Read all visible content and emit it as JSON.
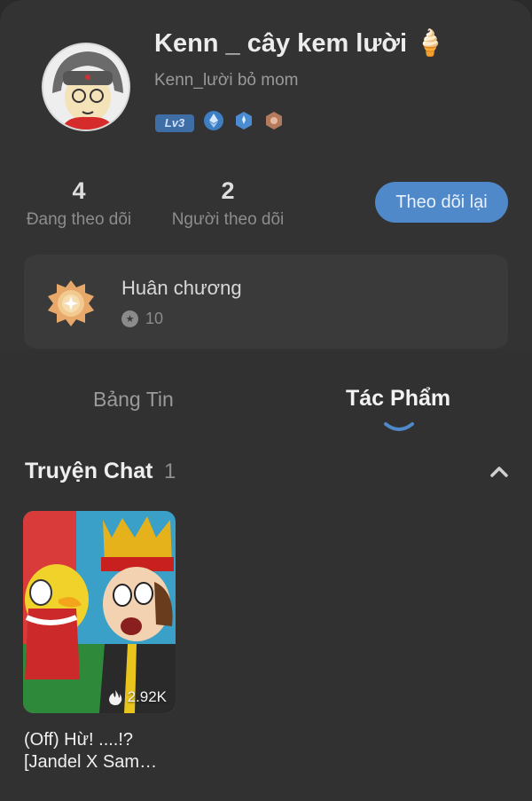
{
  "profile": {
    "display_name": "Kenn _ cây kem lười 🍦",
    "username": "Kenn_lười bỏ mom",
    "level_badge": "Lv3"
  },
  "stats": {
    "following_count": "4",
    "following_label": "Đang theo dõi",
    "followers_count": "2",
    "followers_label": "Người theo dõi",
    "follow_back_label": "Theo dõi lại"
  },
  "medals": {
    "title": "Huân chương",
    "count": "10"
  },
  "tabs": [
    {
      "label": "Bảng Tin",
      "active": false
    },
    {
      "label": "Tác Phẩm",
      "active": true
    }
  ],
  "section": {
    "title": "Truyện Chat",
    "count": "1"
  },
  "works": [
    {
      "title": "(Off) Hừ! ....!? [Jandel X Sam…",
      "views": "2.92K"
    }
  ],
  "colors": {
    "accent": "#4f89c9",
    "background": "#313132",
    "card": "#3a3a3b"
  }
}
